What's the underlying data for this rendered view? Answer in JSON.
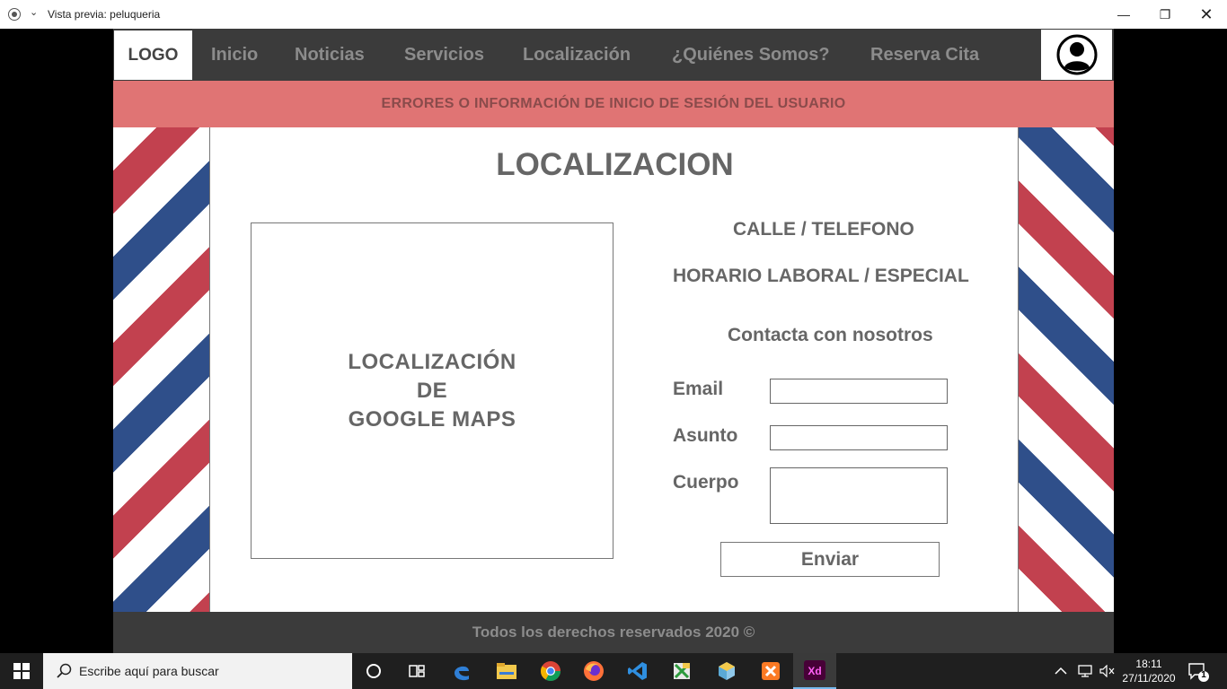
{
  "window": {
    "title": "Vista previa: peluqueria",
    "minimize_glyph": "—",
    "maximize_glyph": "❐",
    "close_glyph": "✕"
  },
  "nav": {
    "logo": "LOGO",
    "items": [
      "Inicio",
      "Noticias",
      "Servicios",
      "Localización",
      "¿Quiénes Somos?",
      "Reserva Cita"
    ]
  },
  "message_bar": "ERRORES O INFORMACIÓN DE INICIO DE SESIÓN DEL USUARIO",
  "page": {
    "title": "LOCALIZACION",
    "map_lines": [
      "LOCALIZACIÓN",
      "DE",
      "GOOGLE MAPS"
    ],
    "street_phone": "CALLE / TELEFONO",
    "hours": "HORARIO LABORAL / ESPECIAL",
    "contact_title": "Contacta con nosotros",
    "form": {
      "email_label": "Email",
      "email_value": "",
      "subject_label": "Asunto",
      "subject_value": "",
      "body_label": "Cuerpo",
      "body_value": "",
      "send_label": "Enviar"
    }
  },
  "footer": "Todos los derechos reservados 2020 ©",
  "taskbar": {
    "search_placeholder": "Escribe aquí para buscar",
    "time": "18:11",
    "date": "27/11/2020",
    "notification_count": "1",
    "apps": [
      "cortana-icon",
      "task-view-icon",
      "edge-icon",
      "file-explorer-icon",
      "chrome-icon",
      "firefox-icon",
      "vscode-icon",
      "xampp-icon",
      "virtualbox-icon",
      "xampp-control-icon",
      "adobe-xd-icon"
    ],
    "xd_label": "Xd"
  },
  "colors": {
    "nav_bg": "#3b3b3b",
    "nav_text": "#8c8c8c",
    "message_bg": "#e07474",
    "stripe_red": "#c2414f",
    "stripe_blue": "#2f4f8a"
  }
}
